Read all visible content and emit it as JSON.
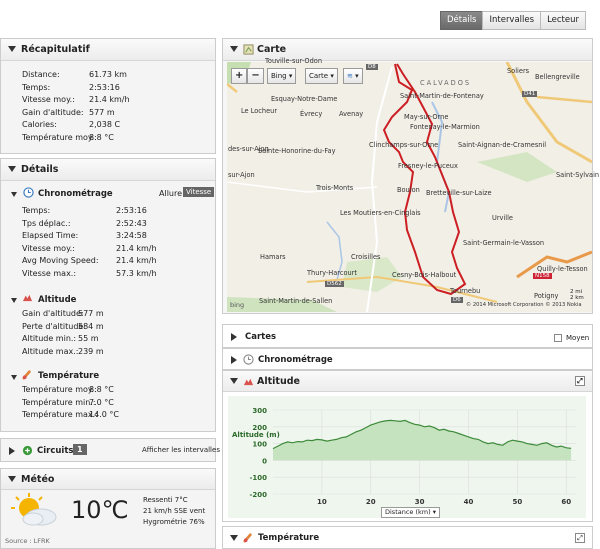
{
  "tabs": [
    "Détails",
    "Intervalles",
    "Lecteur"
  ],
  "summary": {
    "title": "Récapitulatif",
    "rows": [
      {
        "label": "Distance:",
        "value": "61.73 km"
      },
      {
        "label": "Temps:",
        "value": "2:53:16"
      },
      {
        "label": "Vitesse moy.:",
        "value": "21.4 km/h"
      },
      {
        "label": "Gain d'altitude:",
        "value": "577 m"
      },
      {
        "label": "Calories:",
        "value": "2,038 C"
      },
      {
        "label": "Température moy.:",
        "value": "8.8 °C"
      }
    ]
  },
  "details": {
    "title": "Détails",
    "timing": {
      "title": "Chronométrage",
      "toggle": [
        "Allure",
        "Vitesse"
      ],
      "rows": [
        {
          "label": "Temps:",
          "value": "2:53:16"
        },
        {
          "label": "Tps déplac.:",
          "value": "2:52:43"
        },
        {
          "label": "Elapsed Time:",
          "value": "3:24:58"
        },
        {
          "label": "Vitesse moy.:",
          "value": "21.4 km/h"
        },
        {
          "label": "Avg Moving Speed:",
          "value": "21.4 km/h"
        },
        {
          "label": "Vitesse max.:",
          "value": "57.3 km/h"
        }
      ]
    },
    "altitude": {
      "title": "Altitude",
      "rows": [
        {
          "label": "Gain d'altitude:",
          "value": "577 m"
        },
        {
          "label": "Perte d'altitude:",
          "value": "584 m"
        },
        {
          "label": "Altitude min.:",
          "value": "55 m"
        },
        {
          "label": "Altitude max.:",
          "value": "239 m"
        }
      ]
    },
    "temperature": {
      "title": "Température",
      "rows": [
        {
          "label": "Température moy.:",
          "value": "8.8 °C"
        },
        {
          "label": "Température min.:",
          "value": "7.0 °C"
        },
        {
          "label": "Température max.:",
          "value": "14.0 °C"
        }
      ]
    }
  },
  "circuits": {
    "title": "Circuits",
    "count": "1",
    "link": "Afficher les intervalles"
  },
  "weather": {
    "title": "Météo",
    "temp": "10℃",
    "ressenti": "Ressenti 7°C",
    "wind": "21 km/h SSE vent",
    "humidity": "Hygrométrie 76%",
    "source": "Source : LFRK"
  },
  "map": {
    "title": "Carte",
    "provider": "Bing",
    "type": "Carte",
    "credit": "© 2014 Microsoft Corporation   © 2013 Nokia",
    "scale_mi": "2 mi",
    "scale_km": "2 km",
    "logo": "bing",
    "towns": [
      "Touville-sur-Odon",
      "Soliers",
      "Bellengreville",
      "Esquay-Notre-Dame",
      "Saint-Martin-de-Fontenay",
      "Le Locheur",
      "Évrecy",
      "Avenay",
      "May-sur-Orne",
      "Fontenay-le-Marmion",
      "Saint-Aignan-de-Cramesnil",
      "des-sur-Ajon",
      "Clinchamps-sur-Orne",
      "Saint-Sylvain",
      "Sainte-Honorine-du-Fay",
      "Fresney-le-Puceux",
      "sur-Ajon",
      "Trois-Monts",
      "Bretteville-sur-Laize",
      "Boulon",
      "Urville",
      "Les Moutiers-en-Cinglais",
      "Croisilles",
      "Saint-Germain-le-Vasson",
      "Hamars",
      "Quilly-le-Tesson",
      "Thury-Harcourt",
      "Cesny-Bois-Halbout",
      "Tournebu",
      "Saint-Martin-de-Sallen",
      "Potigny",
      "CALVADOS"
    ],
    "roads": [
      "D8",
      "D41",
      "D562",
      "N158",
      "D6"
    ]
  },
  "cartes": {
    "title": "Cartes",
    "moyen": "Moyen"
  },
  "chrono_section": {
    "title": "Chronométrage"
  },
  "altitude_chart_section": {
    "title": "Altitude"
  },
  "temperature_section": {
    "title": "Température"
  },
  "chart_data": {
    "type": "area",
    "ylabel": "Altitude (m)",
    "xlabel": "Distance (km)",
    "ylim": [
      -200,
      300
    ],
    "yticks": [
      300,
      200,
      100,
      0,
      -100,
      -200
    ],
    "xlim": [
      0,
      62
    ],
    "xticks": [
      10,
      20,
      30,
      40,
      50,
      60
    ],
    "x": [
      0,
      1,
      2,
      3,
      4,
      5,
      6,
      7,
      8,
      9,
      10,
      11,
      12,
      13,
      14,
      15,
      16,
      17,
      18,
      19,
      20,
      21,
      22,
      23,
      24,
      25,
      26,
      27,
      28,
      29,
      30,
      31,
      32,
      33,
      34,
      35,
      36,
      37,
      38,
      39,
      40,
      41,
      42,
      43,
      44,
      45,
      46,
      47,
      48,
      49,
      50,
      51,
      52,
      53,
      54,
      55,
      56,
      57,
      58,
      59,
      60,
      61
    ],
    "series": [
      {
        "values": [
          70,
          85,
          100,
          110,
          105,
          112,
          110,
          120,
          118,
          125,
          122,
          115,
          120,
          125,
          135,
          140,
          155,
          170,
          180,
          195,
          210,
          220,
          230,
          235,
          238,
          236,
          232,
          238,
          225,
          215,
          210,
          200,
          205,
          195,
          180,
          185,
          175,
          170,
          160,
          150,
          140,
          130,
          125,
          110,
          100,
          105,
          95,
          90,
          110,
          120,
          115,
          110,
          100,
          95,
          90,
          100,
          105,
          90,
          80,
          85,
          75,
          72
        ]
      }
    ],
    "grid": true,
    "legend": "none"
  },
  "colors": {
    "accent": "#666666",
    "area_fill": "#c6e3c0",
    "area_line": "#3d8a3a",
    "route": "#cc1f24",
    "grid": "#dddddd"
  }
}
